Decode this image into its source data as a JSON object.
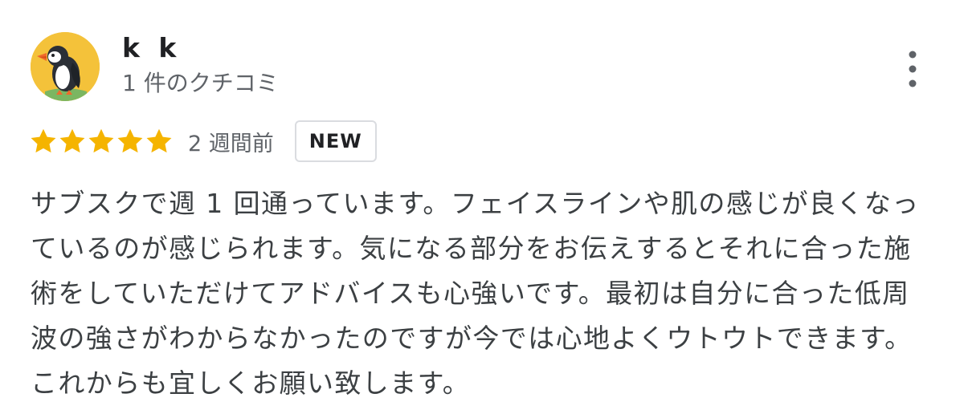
{
  "review": {
    "author_name": "k k",
    "author_meta": "1 件のクチコミ",
    "rating": 5,
    "rating_max": 5,
    "date": "2 週間前",
    "badge": "NEW",
    "text": "サブスクで週 1 回通っています。フェイスラインや肌の感じが良くなっているのが感じられます。気になる部分をお伝えするとそれに合った施術をしていただけてアドバイスも心強いです。最初は自分に合った低周波の強さがわからなかったのですが今では心地よくウトウトできます。これからも宜しくお願い致します。"
  },
  "icons": {
    "avatar": "puffin-avatar",
    "more": "more-vert-icon",
    "star": "star-icon"
  },
  "colors": {
    "star": "#f5b400",
    "avatar_bg": "#f4c23a",
    "text": "#3c4043",
    "meta": "#5f6368",
    "badge_border": "#dadce0"
  }
}
